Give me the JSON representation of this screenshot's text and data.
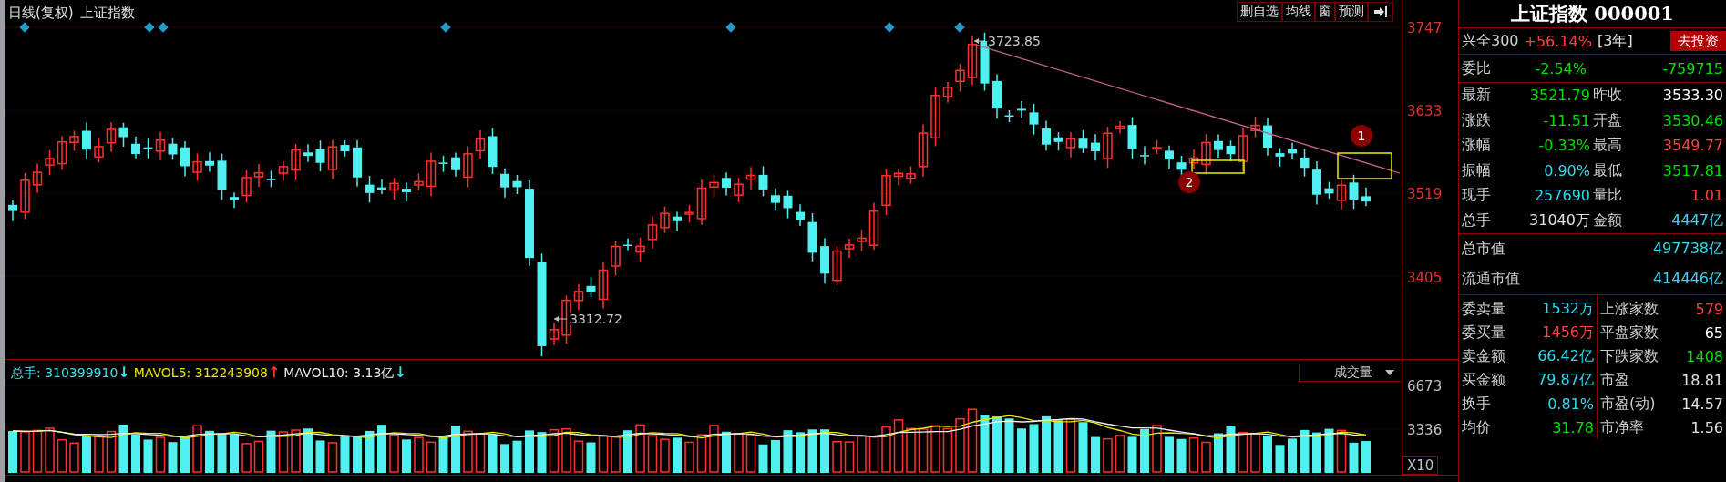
{
  "chart_header": {
    "period": "日线(复权)",
    "name": "上证指数"
  },
  "toolbar": [
    {
      "label": "删自选"
    },
    {
      "label": "均线"
    },
    {
      "label": "窗"
    },
    {
      "label": "预测"
    }
  ],
  "price_axis": [
    "3747",
    "3633",
    "3519",
    "3405"
  ],
  "annotations": {
    "high_label": "3723.85",
    "low_label": "3312.72",
    "markers": [
      "1",
      "2"
    ]
  },
  "volume": {
    "legend": [
      {
        "kind": "value",
        "text": "总手: 310399910",
        "color": "#40e0e8"
      },
      {
        "kind": "arrow",
        "text": "↓",
        "color": "#40e0e8"
      },
      {
        "kind": "value",
        "text": "MAVOL5: 312243908",
        "color": "#e8e800"
      },
      {
        "kind": "arrow",
        "text": "↑",
        "color": "#ff3030"
      },
      {
        "kind": "value",
        "text": "MAVOL10: 3.13亿",
        "color": "#e8e8e8"
      },
      {
        "kind": "arrow",
        "text": "↓",
        "color": "#40e0e8"
      }
    ],
    "selector": "成交量",
    "axis": [
      "6673",
      "3336"
    ],
    "scale": "X10"
  },
  "quote": {
    "title": "上证指数 000001",
    "promo": {
      "fund": "兴全300",
      "return": "+56.14%",
      "period": "[3年]",
      "button": "去投资"
    },
    "ratio": {
      "label": "委比",
      "percent": "-2.54%",
      "amount": "-759715"
    },
    "fields": [
      {
        "label": "最新",
        "value": "3521.79",
        "color": "#00e000"
      },
      {
        "label": "昨收",
        "value": "3533.30",
        "color": "#ffffff"
      },
      {
        "label": "涨跌",
        "value": "-11.51",
        "color": "#00e000"
      },
      {
        "label": "开盘",
        "value": "3530.46",
        "color": "#00e000"
      },
      {
        "label": "涨幅",
        "value": "-0.33%",
        "color": "#00e000"
      },
      {
        "label": "最高",
        "value": "3549.77",
        "color": "#ff4040"
      },
      {
        "label": "振幅",
        "value": "0.90%",
        "color": "#30d8f0"
      },
      {
        "label": "最低",
        "value": "3517.81",
        "color": "#00e000"
      },
      {
        "label": "现手",
        "value": "257690",
        "color": "#30d8f0"
      },
      {
        "label": "量比",
        "value": "1.01",
        "color": "#ff4040"
      },
      {
        "label": "总手",
        "value": "31040万",
        "color": "#e0e0e0"
      },
      {
        "label": "金额",
        "value": "4447亿",
        "color": "#30d8f0"
      }
    ],
    "market_cap": [
      {
        "label": "总市值",
        "value": "497738亿"
      },
      {
        "label": "流通市值",
        "value": "414446亿"
      }
    ],
    "orders": [
      {
        "label": "委卖量",
        "value": "1532万",
        "color": "#30d8f0"
      },
      {
        "label": "委买量",
        "value": "1456万",
        "color": "#ff4040"
      },
      {
        "label": "卖金额",
        "value": "66.42亿",
        "color": "#30d8f0"
      },
      {
        "label": "买金额",
        "value": "79.87亿",
        "color": "#30d8f0"
      },
      {
        "label": "换手",
        "value": "0.81%",
        "color": "#30d8f0"
      },
      {
        "label": "均价",
        "value": "31.78",
        "color": "#00e000"
      }
    ],
    "breadth": [
      {
        "label": "上涨家数",
        "value": "579",
        "color": "#ff4040"
      },
      {
        "label": "平盘家数",
        "value": "65",
        "color": "#ffffff"
      },
      {
        "label": "下跌家数",
        "value": "1408",
        "color": "#00e000"
      },
      {
        "label": "市盈",
        "value": "18.81",
        "color": "#e0e0e0"
      },
      {
        "label": "市盈(动)",
        "value": "14.57",
        "color": "#e0e0e0"
      },
      {
        "label": "市净率",
        "value": "1.56",
        "color": "#e0e0e0"
      }
    ]
  }
}
